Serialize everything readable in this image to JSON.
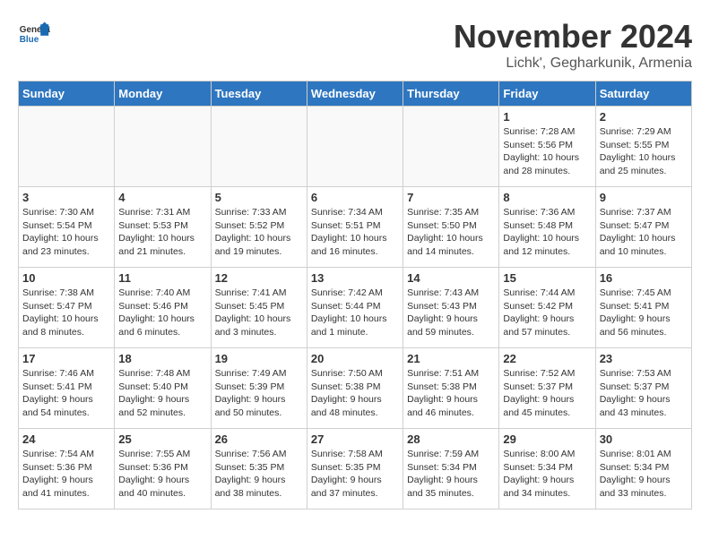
{
  "header": {
    "logo_general": "General",
    "logo_blue": "Blue",
    "title": "November 2024",
    "subtitle": "Lichk', Gegharkunik, Armenia"
  },
  "days_of_week": [
    "Sunday",
    "Monday",
    "Tuesday",
    "Wednesday",
    "Thursday",
    "Friday",
    "Saturday"
  ],
  "weeks": [
    [
      {
        "day": "",
        "detail": ""
      },
      {
        "day": "",
        "detail": ""
      },
      {
        "day": "",
        "detail": ""
      },
      {
        "day": "",
        "detail": ""
      },
      {
        "day": "",
        "detail": ""
      },
      {
        "day": "1",
        "detail": "Sunrise: 7:28 AM\nSunset: 5:56 PM\nDaylight: 10 hours\nand 28 minutes."
      },
      {
        "day": "2",
        "detail": "Sunrise: 7:29 AM\nSunset: 5:55 PM\nDaylight: 10 hours\nand 25 minutes."
      }
    ],
    [
      {
        "day": "3",
        "detail": "Sunrise: 7:30 AM\nSunset: 5:54 PM\nDaylight: 10 hours\nand 23 minutes."
      },
      {
        "day": "4",
        "detail": "Sunrise: 7:31 AM\nSunset: 5:53 PM\nDaylight: 10 hours\nand 21 minutes."
      },
      {
        "day": "5",
        "detail": "Sunrise: 7:33 AM\nSunset: 5:52 PM\nDaylight: 10 hours\nand 19 minutes."
      },
      {
        "day": "6",
        "detail": "Sunrise: 7:34 AM\nSunset: 5:51 PM\nDaylight: 10 hours\nand 16 minutes."
      },
      {
        "day": "7",
        "detail": "Sunrise: 7:35 AM\nSunset: 5:50 PM\nDaylight: 10 hours\nand 14 minutes."
      },
      {
        "day": "8",
        "detail": "Sunrise: 7:36 AM\nSunset: 5:48 PM\nDaylight: 10 hours\nand 12 minutes."
      },
      {
        "day": "9",
        "detail": "Sunrise: 7:37 AM\nSunset: 5:47 PM\nDaylight: 10 hours\nand 10 minutes."
      }
    ],
    [
      {
        "day": "10",
        "detail": "Sunrise: 7:38 AM\nSunset: 5:47 PM\nDaylight: 10 hours\nand 8 minutes."
      },
      {
        "day": "11",
        "detail": "Sunrise: 7:40 AM\nSunset: 5:46 PM\nDaylight: 10 hours\nand 6 minutes."
      },
      {
        "day": "12",
        "detail": "Sunrise: 7:41 AM\nSunset: 5:45 PM\nDaylight: 10 hours\nand 3 minutes."
      },
      {
        "day": "13",
        "detail": "Sunrise: 7:42 AM\nSunset: 5:44 PM\nDaylight: 10 hours\nand 1 minute."
      },
      {
        "day": "14",
        "detail": "Sunrise: 7:43 AM\nSunset: 5:43 PM\nDaylight: 9 hours\nand 59 minutes."
      },
      {
        "day": "15",
        "detail": "Sunrise: 7:44 AM\nSunset: 5:42 PM\nDaylight: 9 hours\nand 57 minutes."
      },
      {
        "day": "16",
        "detail": "Sunrise: 7:45 AM\nSunset: 5:41 PM\nDaylight: 9 hours\nand 56 minutes."
      }
    ],
    [
      {
        "day": "17",
        "detail": "Sunrise: 7:46 AM\nSunset: 5:41 PM\nDaylight: 9 hours\nand 54 minutes."
      },
      {
        "day": "18",
        "detail": "Sunrise: 7:48 AM\nSunset: 5:40 PM\nDaylight: 9 hours\nand 52 minutes."
      },
      {
        "day": "19",
        "detail": "Sunrise: 7:49 AM\nSunset: 5:39 PM\nDaylight: 9 hours\nand 50 minutes."
      },
      {
        "day": "20",
        "detail": "Sunrise: 7:50 AM\nSunset: 5:38 PM\nDaylight: 9 hours\nand 48 minutes."
      },
      {
        "day": "21",
        "detail": "Sunrise: 7:51 AM\nSunset: 5:38 PM\nDaylight: 9 hours\nand 46 minutes."
      },
      {
        "day": "22",
        "detail": "Sunrise: 7:52 AM\nSunset: 5:37 PM\nDaylight: 9 hours\nand 45 minutes."
      },
      {
        "day": "23",
        "detail": "Sunrise: 7:53 AM\nSunset: 5:37 PM\nDaylight: 9 hours\nand 43 minutes."
      }
    ],
    [
      {
        "day": "24",
        "detail": "Sunrise: 7:54 AM\nSunset: 5:36 PM\nDaylight: 9 hours\nand 41 minutes."
      },
      {
        "day": "25",
        "detail": "Sunrise: 7:55 AM\nSunset: 5:36 PM\nDaylight: 9 hours\nand 40 minutes."
      },
      {
        "day": "26",
        "detail": "Sunrise: 7:56 AM\nSunset: 5:35 PM\nDaylight: 9 hours\nand 38 minutes."
      },
      {
        "day": "27",
        "detail": "Sunrise: 7:58 AM\nSunset: 5:35 PM\nDaylight: 9 hours\nand 37 minutes."
      },
      {
        "day": "28",
        "detail": "Sunrise: 7:59 AM\nSunset: 5:34 PM\nDaylight: 9 hours\nand 35 minutes."
      },
      {
        "day": "29",
        "detail": "Sunrise: 8:00 AM\nSunset: 5:34 PM\nDaylight: 9 hours\nand 34 minutes."
      },
      {
        "day": "30",
        "detail": "Sunrise: 8:01 AM\nSunset: 5:34 PM\nDaylight: 9 hours\nand 33 minutes."
      }
    ]
  ]
}
